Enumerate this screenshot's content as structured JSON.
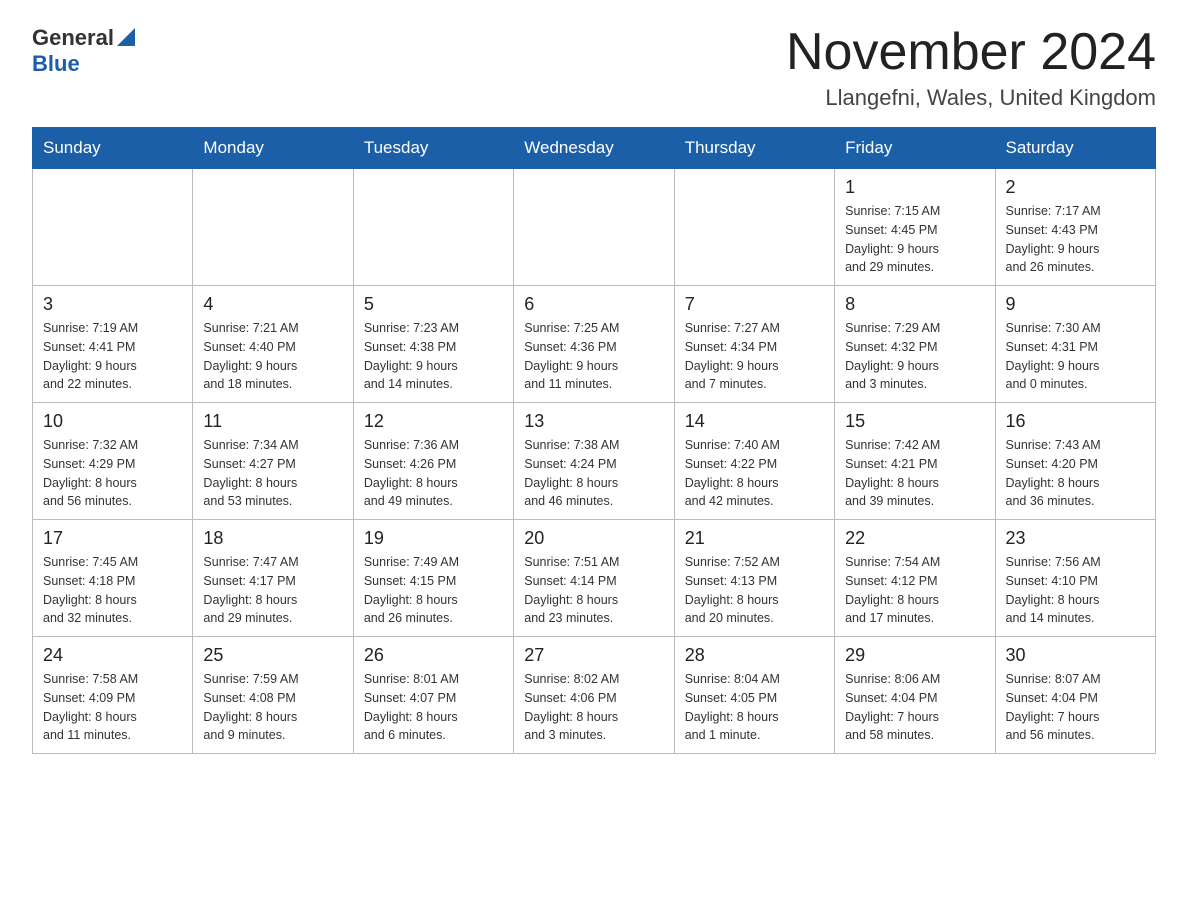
{
  "header": {
    "logo_general": "General",
    "logo_blue": "Blue",
    "month_title": "November 2024",
    "location": "Llangefni, Wales, United Kingdom"
  },
  "weekdays": [
    "Sunday",
    "Monday",
    "Tuesday",
    "Wednesday",
    "Thursday",
    "Friday",
    "Saturday"
  ],
  "weeks": [
    [
      {
        "day": "",
        "info": ""
      },
      {
        "day": "",
        "info": ""
      },
      {
        "day": "",
        "info": ""
      },
      {
        "day": "",
        "info": ""
      },
      {
        "day": "",
        "info": ""
      },
      {
        "day": "1",
        "info": "Sunrise: 7:15 AM\nSunset: 4:45 PM\nDaylight: 9 hours\nand 29 minutes."
      },
      {
        "day": "2",
        "info": "Sunrise: 7:17 AM\nSunset: 4:43 PM\nDaylight: 9 hours\nand 26 minutes."
      }
    ],
    [
      {
        "day": "3",
        "info": "Sunrise: 7:19 AM\nSunset: 4:41 PM\nDaylight: 9 hours\nand 22 minutes."
      },
      {
        "day": "4",
        "info": "Sunrise: 7:21 AM\nSunset: 4:40 PM\nDaylight: 9 hours\nand 18 minutes."
      },
      {
        "day": "5",
        "info": "Sunrise: 7:23 AM\nSunset: 4:38 PM\nDaylight: 9 hours\nand 14 minutes."
      },
      {
        "day": "6",
        "info": "Sunrise: 7:25 AM\nSunset: 4:36 PM\nDaylight: 9 hours\nand 11 minutes."
      },
      {
        "day": "7",
        "info": "Sunrise: 7:27 AM\nSunset: 4:34 PM\nDaylight: 9 hours\nand 7 minutes."
      },
      {
        "day": "8",
        "info": "Sunrise: 7:29 AM\nSunset: 4:32 PM\nDaylight: 9 hours\nand 3 minutes."
      },
      {
        "day": "9",
        "info": "Sunrise: 7:30 AM\nSunset: 4:31 PM\nDaylight: 9 hours\nand 0 minutes."
      }
    ],
    [
      {
        "day": "10",
        "info": "Sunrise: 7:32 AM\nSunset: 4:29 PM\nDaylight: 8 hours\nand 56 minutes."
      },
      {
        "day": "11",
        "info": "Sunrise: 7:34 AM\nSunset: 4:27 PM\nDaylight: 8 hours\nand 53 minutes."
      },
      {
        "day": "12",
        "info": "Sunrise: 7:36 AM\nSunset: 4:26 PM\nDaylight: 8 hours\nand 49 minutes."
      },
      {
        "day": "13",
        "info": "Sunrise: 7:38 AM\nSunset: 4:24 PM\nDaylight: 8 hours\nand 46 minutes."
      },
      {
        "day": "14",
        "info": "Sunrise: 7:40 AM\nSunset: 4:22 PM\nDaylight: 8 hours\nand 42 minutes."
      },
      {
        "day": "15",
        "info": "Sunrise: 7:42 AM\nSunset: 4:21 PM\nDaylight: 8 hours\nand 39 minutes."
      },
      {
        "day": "16",
        "info": "Sunrise: 7:43 AM\nSunset: 4:20 PM\nDaylight: 8 hours\nand 36 minutes."
      }
    ],
    [
      {
        "day": "17",
        "info": "Sunrise: 7:45 AM\nSunset: 4:18 PM\nDaylight: 8 hours\nand 32 minutes."
      },
      {
        "day": "18",
        "info": "Sunrise: 7:47 AM\nSunset: 4:17 PM\nDaylight: 8 hours\nand 29 minutes."
      },
      {
        "day": "19",
        "info": "Sunrise: 7:49 AM\nSunset: 4:15 PM\nDaylight: 8 hours\nand 26 minutes."
      },
      {
        "day": "20",
        "info": "Sunrise: 7:51 AM\nSunset: 4:14 PM\nDaylight: 8 hours\nand 23 minutes."
      },
      {
        "day": "21",
        "info": "Sunrise: 7:52 AM\nSunset: 4:13 PM\nDaylight: 8 hours\nand 20 minutes."
      },
      {
        "day": "22",
        "info": "Sunrise: 7:54 AM\nSunset: 4:12 PM\nDaylight: 8 hours\nand 17 minutes."
      },
      {
        "day": "23",
        "info": "Sunrise: 7:56 AM\nSunset: 4:10 PM\nDaylight: 8 hours\nand 14 minutes."
      }
    ],
    [
      {
        "day": "24",
        "info": "Sunrise: 7:58 AM\nSunset: 4:09 PM\nDaylight: 8 hours\nand 11 minutes."
      },
      {
        "day": "25",
        "info": "Sunrise: 7:59 AM\nSunset: 4:08 PM\nDaylight: 8 hours\nand 9 minutes."
      },
      {
        "day": "26",
        "info": "Sunrise: 8:01 AM\nSunset: 4:07 PM\nDaylight: 8 hours\nand 6 minutes."
      },
      {
        "day": "27",
        "info": "Sunrise: 8:02 AM\nSunset: 4:06 PM\nDaylight: 8 hours\nand 3 minutes."
      },
      {
        "day": "28",
        "info": "Sunrise: 8:04 AM\nSunset: 4:05 PM\nDaylight: 8 hours\nand 1 minute."
      },
      {
        "day": "29",
        "info": "Sunrise: 8:06 AM\nSunset: 4:04 PM\nDaylight: 7 hours\nand 58 minutes."
      },
      {
        "day": "30",
        "info": "Sunrise: 8:07 AM\nSunset: 4:04 PM\nDaylight: 7 hours\nand 56 minutes."
      }
    ]
  ]
}
